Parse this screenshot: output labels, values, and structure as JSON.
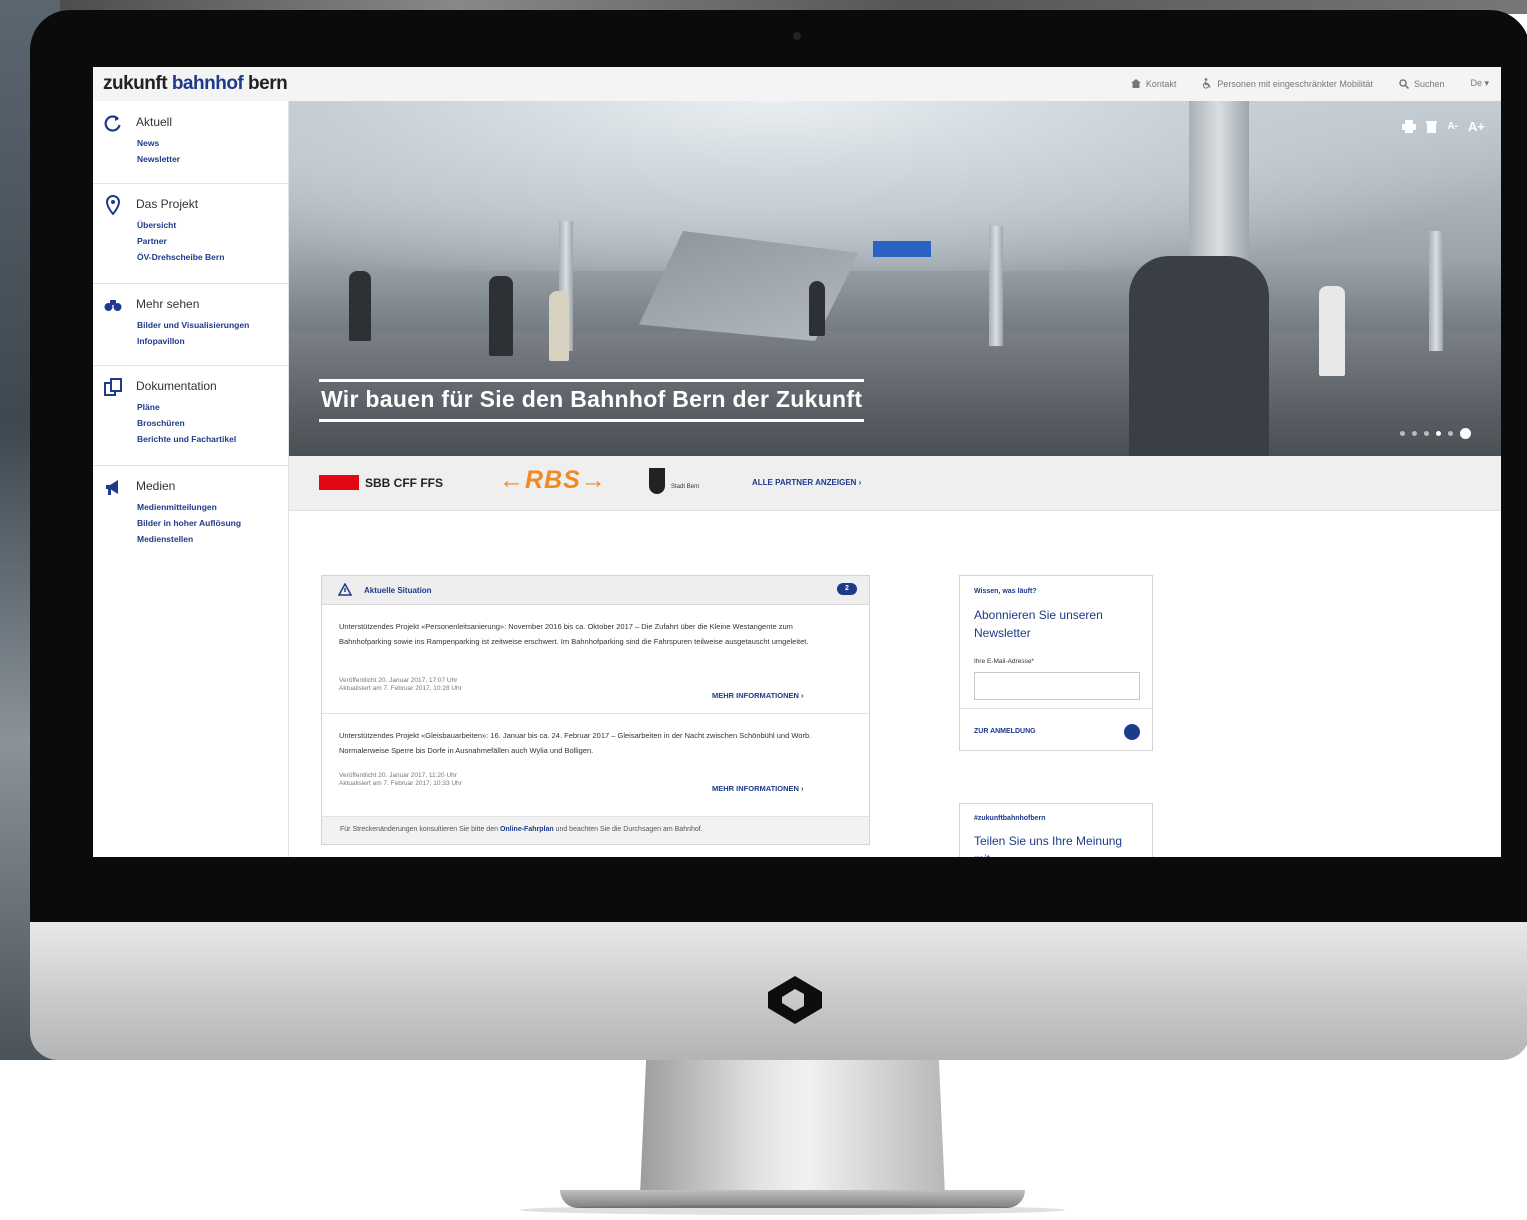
{
  "site": {
    "logo_part1": "zukunft ",
    "logo_part2": "bahnhof",
    "logo_part3": " bern"
  },
  "topbar": {
    "links": [
      {
        "label": "Kontakt",
        "icon": "home-icon"
      },
      {
        "label": "Personen mit eingeschränkter Mobilität",
        "icon": "wheelchair-icon"
      },
      {
        "label": "Suchen",
        "icon": "search-icon"
      },
      {
        "label": "De ▾",
        "icon": ""
      }
    ]
  },
  "sidebar": {
    "sections": [
      {
        "title": "Aktuell",
        "icon": "refresh-icon",
        "items": [
          "News",
          "Newsletter"
        ]
      },
      {
        "title": "Das Projekt",
        "icon": "pin-icon",
        "items": [
          "Übersicht",
          "Partner",
          "ÖV-Drehscheibe Bern"
        ]
      },
      {
        "title": "Mehr sehen",
        "icon": "binoculars-icon",
        "items": [
          "Bilder und Visualisierungen",
          "Infopavillon"
        ]
      },
      {
        "title": "Dokumentation",
        "icon": "documents-icon",
        "items": [
          "Pläne",
          "Broschüren",
          "Berichte und Fachartikel"
        ]
      },
      {
        "title": "Medien",
        "icon": "megaphone-icon",
        "items": [
          "Medienmitteilungen",
          "Bilder in hoher Auflösung",
          "Medienstellen"
        ]
      }
    ]
  },
  "hero": {
    "caption": "Wir bauen für Sie den Bahnhof Bern der Zukunft",
    "tools": [
      "print-icon",
      "trash-icon",
      "A-",
      "A+"
    ],
    "slides_total": 5,
    "slide_active": 4
  },
  "partners": {
    "sbb": "SBB CFF FFS",
    "rbs": "←RBS→",
    "bern_label": "Stadt Bern",
    "all_link": "ALLE PARTNER ANZEIGEN  ›"
  },
  "news": {
    "title": "Aktuelle Situation",
    "count": "2",
    "items": [
      {
        "text": "Unterstützendes Projekt «Personenleitsanierung»: November 2016 bis ca. Oktober 2017 – Die Zufahrt über die Kleine Westangente zum Bahnhofparking sowie ins Rampenparking ist zeitweise erschwert. Im Bahnhofparking sind die Fahrspuren teilweise ausgetauscht umgeleitet.",
        "meta1": "Veröffentlicht 20. Januar 2017, 17:07 Uhr",
        "meta2": "Aktualisiert am 7. Februar 2017, 10:28 Uhr",
        "more": "MEHR INFORMATIONEN  ›"
      },
      {
        "text": "Unterstützendes Projekt «Gleisbauarbeiten»: 16. Januar bis ca. 24. Februar 2017 – Gleisarbeiten in der Nacht zwischen Schönbühl und Worb. Normalerweise Sperre bis Dorfe in Ausnahmefällen auch Wylia und Bolligen.",
        "meta1": "Veröffentlicht 20. Januar 2017, 11:20 Uhr",
        "meta2": "Aktualisiert am 7. Februar 2017, 10:33 Uhr",
        "more": "MEHR INFORMATIONEN  ›"
      }
    ],
    "footer_pre": "Für Streckenänderungen konsultieren Sie bitte den ",
    "footer_link": "Online-Fahrplan",
    "footer_post": " und beachten Sie die Durchsagen am Bahnhof."
  },
  "newsletter": {
    "heading": "Wissen, was läuft?",
    "title": "Abonnieren Sie unseren Newsletter",
    "label": "Ihre E-Mail-Adresse*",
    "input_value": "",
    "cta": "ZUR ANMELDUNG"
  },
  "feedback": {
    "heading": "#zukunftbahnhofbern",
    "title": "Teilen Sie uns Ihre Meinung mit"
  },
  "colors": {
    "brand_blue": "#1e3a8a",
    "sbb_red": "#e30613",
    "rbs_orange": "#f08a24"
  }
}
